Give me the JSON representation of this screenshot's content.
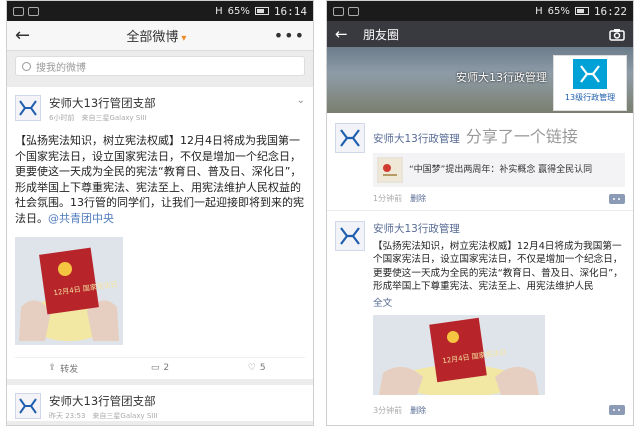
{
  "left": {
    "status": {
      "time": "16:14",
      "signal": "H",
      "battery": "65%"
    },
    "header": {
      "back_label": "←",
      "title": "全部微博",
      "caret": "▾",
      "more": "•••"
    },
    "search": {
      "placeholder": "搜我的微博"
    },
    "posts": [
      {
        "author": "安师大13行管团支部",
        "meta": "6小时前　来自三星Galaxy SIII",
        "text": "【弘扬宪法知识，树立宪法权威】12月4日将成为我国第一个国家宪法日，设立国家宪法日，不仅是增加一个纪念日，更要使这一天成为全民的宪法“教育日、普及日、深化日”，形成举国上下尊重宪法、宪法至上、用宪法维护人民权益的社会氛围。13行管的同学们，让我们一起迎接即将到来的宪法日。",
        "link": "@共青团中央",
        "image_caption": "12月4日 国家宪法日",
        "actions": {
          "repost": "转发",
          "comment": "2",
          "like": "5"
        }
      },
      {
        "author": "安师大13行管团支部",
        "meta": "昨天 23:53　来自三星Galaxy SIII"
      }
    ]
  },
  "right": {
    "status": {
      "time": "16:22",
      "signal": "H",
      "battery": "65%"
    },
    "header": {
      "back_label": "←",
      "title": "朋友圈"
    },
    "cover": {
      "name": "安师大13行政管理",
      "avatar_label": "13级行政管理"
    },
    "posts": [
      {
        "author": "安师大13行政管理",
        "action": "分享了一个链接",
        "share_title": "“中国梦”提出两周年：补实概念 赢得全民认同",
        "time": "1分钟前",
        "delete": "删除"
      },
      {
        "author": "安师大13行政管理",
        "text": "【弘扬宪法知识，树立宪法权威】12月4日将成为我国第一个国家宪法日，设立国家宪法日，不仅是增加一个纪念日，更要使这一天成为全民的宪法“教育日、普及日、深化日”，形成举国上下尊重宪法、宪法至上、用宪法维护人民",
        "more": "全文",
        "image_caption": "12月4日 国家宪法日",
        "time": "3分钟前",
        "delete": "删除"
      }
    ]
  },
  "colors": {
    "moments_header": "#393a3f",
    "link_blue": "#576b95",
    "weibo_accent": "#f08a24"
  }
}
